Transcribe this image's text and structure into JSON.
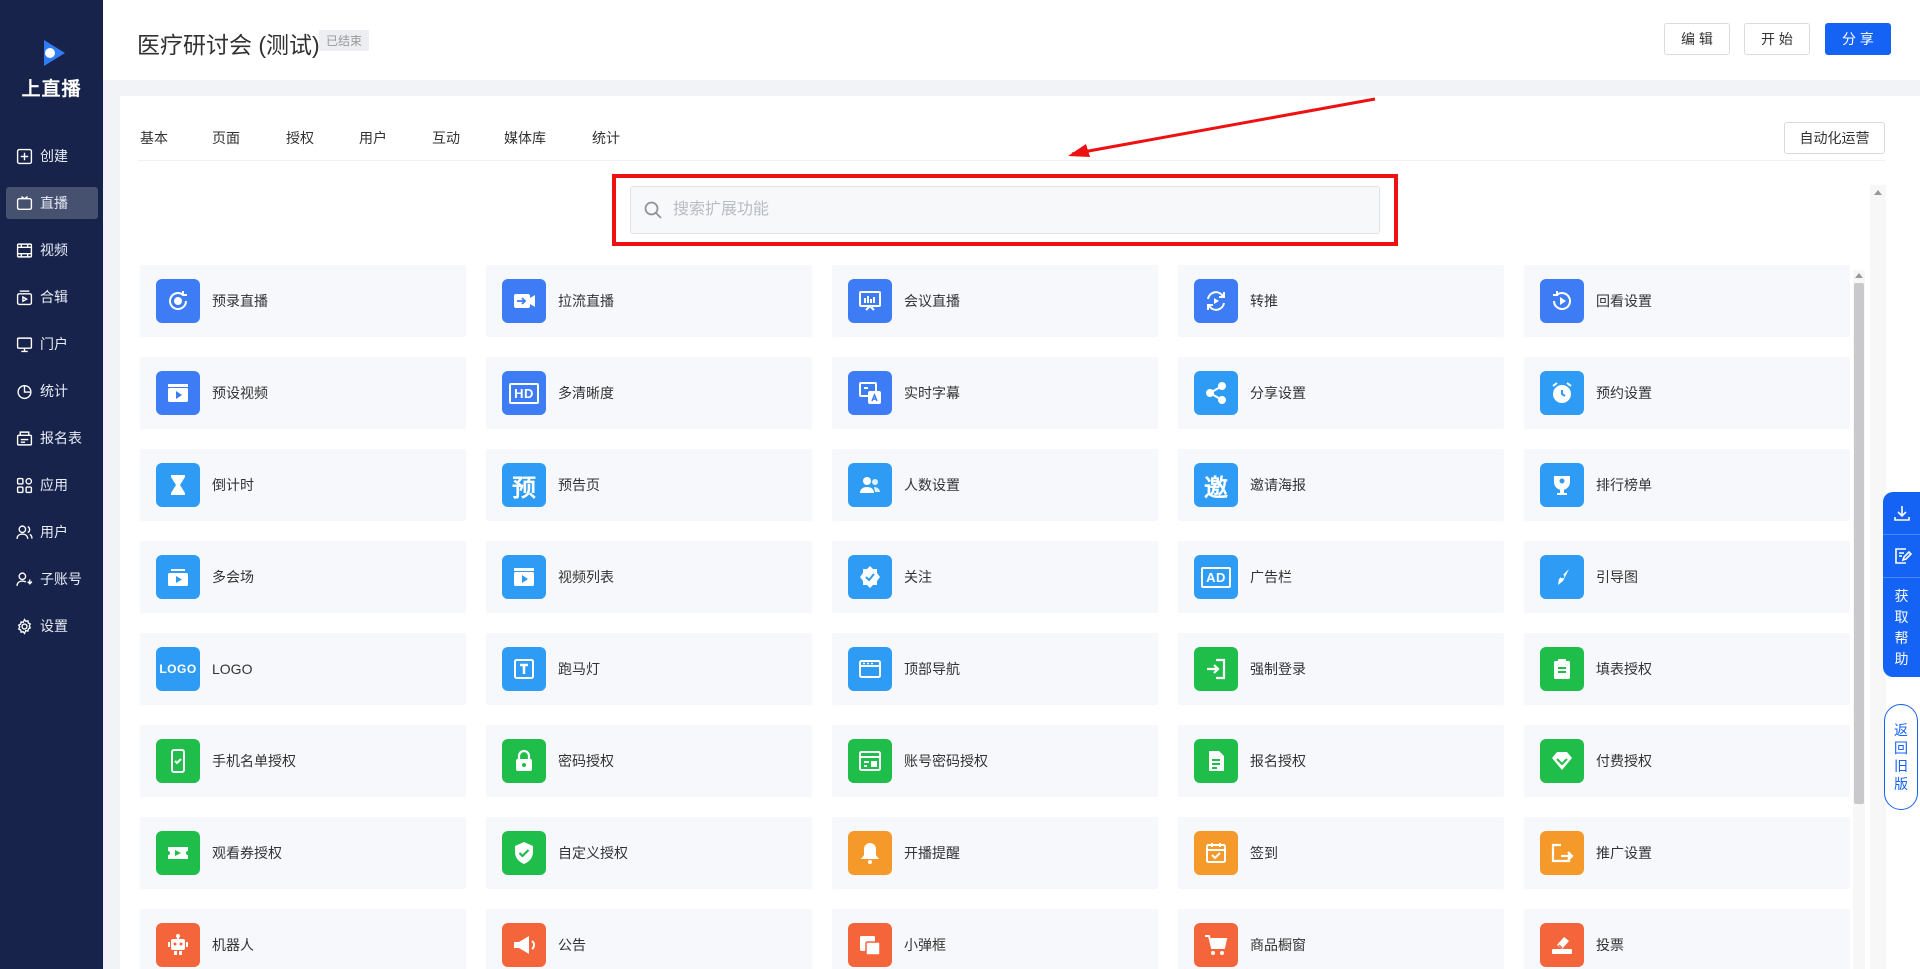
{
  "app": {
    "logo_text": "上直播",
    "logo_icon": "brand-play-icon"
  },
  "sidebar": {
    "items": [
      {
        "label": "创建",
        "icon": "plus-square-icon"
      },
      {
        "label": "直播",
        "icon": "camera-icon",
        "active": true
      },
      {
        "label": "视频",
        "icon": "film-icon"
      },
      {
        "label": "合辑",
        "icon": "collection-icon"
      },
      {
        "label": "门户",
        "icon": "monitor-icon"
      },
      {
        "label": "统计",
        "icon": "pie-chart-icon"
      },
      {
        "label": "报名表",
        "icon": "form-icon"
      },
      {
        "label": "应用",
        "icon": "apps-grid-icon"
      },
      {
        "label": "用户",
        "icon": "users-icon"
      },
      {
        "label": "子账号",
        "icon": "sub-account-icon"
      },
      {
        "label": "设置",
        "icon": "gear-icon"
      }
    ]
  },
  "header": {
    "title": "医疗研讨会 (测试)",
    "status": "已结束",
    "buttons": {
      "edit": "编 辑",
      "start": "开 始",
      "share": "分 享"
    }
  },
  "tabs": [
    "基本",
    "页面",
    "授权",
    "用户",
    "互动",
    "媒体库",
    "统计"
  ],
  "auto_ops_button": "自动化运营",
  "search": {
    "placeholder": "搜索扩展功能",
    "value": ""
  },
  "annotation": {
    "highlight_color": "#ee1111"
  },
  "features": [
    {
      "label": "预录直播",
      "icon": "rerecord-icon",
      "color": "#3d7cf5"
    },
    {
      "label": "拉流直播",
      "icon": "stream-pull-icon",
      "color": "#3d7cf5"
    },
    {
      "label": "会议直播",
      "icon": "meeting-screen-icon",
      "color": "#3d7cf5"
    },
    {
      "label": "转推",
      "icon": "repush-icon",
      "color": "#3d7cf5"
    },
    {
      "label": "回看设置",
      "icon": "playback-icon",
      "color": "#3d7cf5"
    },
    {
      "label": "预设视频",
      "icon": "video-preset-icon",
      "color": "#3d7cf5"
    },
    {
      "label": "多清晰度",
      "icon": "hd-icon",
      "glyph": "HD",
      "color": "#3d7cf5"
    },
    {
      "label": "实时字幕",
      "icon": "subtitle-icon",
      "color": "#3d7cf5"
    },
    {
      "label": "分享设置",
      "icon": "share-nodes-icon",
      "color": "#2e9cf4"
    },
    {
      "label": "预约设置",
      "icon": "alarm-clock-icon",
      "color": "#2e9cf4"
    },
    {
      "label": "倒计时",
      "icon": "hourglass-icon",
      "color": "#2e9cf4"
    },
    {
      "label": "预告页",
      "icon": "preview-page-icon",
      "glyph": "预",
      "color": "#2e9cf4"
    },
    {
      "label": "人数设置",
      "icon": "people-icon",
      "color": "#2e9cf4"
    },
    {
      "label": "邀请海报",
      "icon": "invite-poster-icon",
      "glyph": "邀",
      "color": "#2e9cf4"
    },
    {
      "label": "排行榜单",
      "icon": "trophy-icon",
      "color": "#2e9cf4"
    },
    {
      "label": "多会场",
      "icon": "multi-venue-icon",
      "color": "#2e9cf4"
    },
    {
      "label": "视频列表",
      "icon": "video-list-icon",
      "color": "#2e9cf4"
    },
    {
      "label": "关注",
      "icon": "follow-badge-icon",
      "color": "#2e9cf4"
    },
    {
      "label": "广告栏",
      "icon": "ad-icon",
      "glyph": "AD",
      "color": "#2e9cf4"
    },
    {
      "label": "引导图",
      "icon": "compass-icon",
      "color": "#2e9cf4"
    },
    {
      "label": "LOGO",
      "icon": "logo-icon",
      "glyph": "LOGO",
      "color": "#2e9cf4"
    },
    {
      "label": "跑马灯",
      "icon": "marquee-icon",
      "color": "#2e9cf4"
    },
    {
      "label": "顶部导航",
      "icon": "top-nav-icon",
      "color": "#2e9cf4"
    },
    {
      "label": "强制登录",
      "icon": "login-icon",
      "color": "#1fbd4a"
    },
    {
      "label": "填表授权",
      "icon": "clipboard-icon",
      "color": "#1fbd4a"
    },
    {
      "label": "手机名单授权",
      "icon": "phone-icon",
      "color": "#1fbd4a"
    },
    {
      "label": "密码授权",
      "icon": "lock-icon",
      "color": "#1fbd4a"
    },
    {
      "label": "账号密码授权",
      "icon": "account-password-icon",
      "color": "#1fbd4a"
    },
    {
      "label": "报名授权",
      "icon": "signup-doc-icon",
      "color": "#1fbd4a"
    },
    {
      "label": "付费授权",
      "icon": "diamond-icon",
      "color": "#1fbd4a"
    },
    {
      "label": "观看券授权",
      "icon": "ticket-icon",
      "color": "#1fbd4a"
    },
    {
      "label": "自定义授权",
      "icon": "shield-check-icon",
      "color": "#1fbd4a"
    },
    {
      "label": "开播提醒",
      "icon": "bell-icon",
      "color": "#f59a2a"
    },
    {
      "label": "签到",
      "icon": "checkin-calendar-icon",
      "color": "#f59a2a"
    },
    {
      "label": "推广设置",
      "icon": "promote-icon",
      "color": "#f59a2a"
    },
    {
      "label": "机器人",
      "icon": "robot-icon",
      "color": "#f4653b"
    },
    {
      "label": "公告",
      "icon": "megaphone-icon",
      "color": "#f4653b"
    },
    {
      "label": "小弹框",
      "icon": "popup-icon",
      "color": "#f4653b"
    },
    {
      "label": "商品橱窗",
      "icon": "cart-icon",
      "color": "#f4653b"
    },
    {
      "label": "投票",
      "icon": "vote-icon",
      "color": "#f4653b"
    }
  ],
  "float_help": {
    "text": "获取帮助",
    "icons": [
      "download-icon",
      "feedback-icon"
    ]
  },
  "float_old": {
    "text": "返回旧版"
  },
  "colors": {
    "sidebar_bg": "#17234a",
    "primary": "#1463f5"
  }
}
